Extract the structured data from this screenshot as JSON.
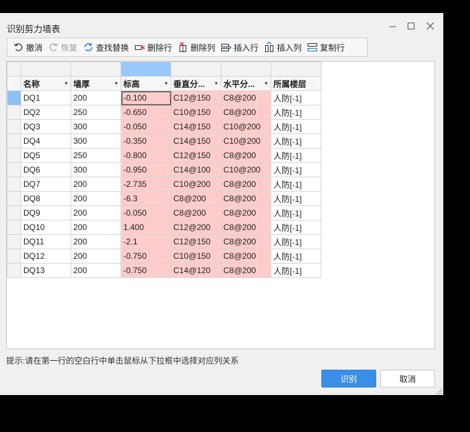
{
  "window": {
    "title": "识别剪力墙表"
  },
  "toolbar": {
    "items": [
      {
        "label": "撤消",
        "icon": "undo-icon",
        "enabled": true
      },
      {
        "label": "恢复",
        "icon": "redo-icon",
        "enabled": false
      },
      {
        "label": "查找替换",
        "icon": "find-replace-icon",
        "enabled": true
      },
      {
        "label": "删除行",
        "icon": "delete-row-icon",
        "enabled": true
      },
      {
        "label": "删除列",
        "icon": "delete-column-icon",
        "enabled": true
      },
      {
        "label": "插入行",
        "icon": "insert-row-icon",
        "enabled": true
      },
      {
        "label": "插入列",
        "icon": "insert-column-icon",
        "enabled": true
      },
      {
        "label": "复制行",
        "icon": "copy-row-icon",
        "enabled": true
      }
    ]
  },
  "grid": {
    "headers": [
      "名称",
      "墙厚",
      "标高",
      "垂直分...",
      "水平分...",
      "所属楼层"
    ],
    "rows": [
      [
        "DQ1",
        "200",
        "-0.100",
        "C12@150",
        "C8@200",
        "人防[-1]"
      ],
      [
        "DQ2",
        "250",
        "-0.650",
        "C10@150",
        "C8@200",
        "人防[-1]"
      ],
      [
        "DQ3",
        "300",
        "-0.050",
        "C14@150",
        "C10@200",
        "人防[-1]"
      ],
      [
        "DQ4",
        "300",
        "-0.350",
        "C14@150",
        "C10@200",
        "人防[-1]"
      ],
      [
        "DQ5",
        "250",
        "-0.800",
        "C12@150",
        "C8@200",
        "人防[-1]"
      ],
      [
        "DQ6",
        "300",
        "-0.950",
        "C14@100",
        "C10@200",
        "人防[-1]"
      ],
      [
        "DQ7",
        "200",
        "-2.735",
        "C10@200",
        "C8@200",
        "人防[-1]"
      ],
      [
        "DQ8",
        "200",
        "-6.3",
        "C8@200",
        "C8@200",
        "人防[-1]"
      ],
      [
        "DQ9",
        "200",
        "-0.050",
        "C8@200",
        "C8@200",
        "人防[-1]"
      ],
      [
        "DQ10",
        "200",
        "1.400",
        "C12@200",
        "C8@200",
        "人防[-1]"
      ],
      [
        "DQ11",
        "200",
        "-2.1",
        "C12@150",
        "C8@200",
        "人防[-1]"
      ],
      [
        "DQ12",
        "200",
        "-0.750",
        "C10@150",
        "C8@200",
        "人防[-1]"
      ],
      [
        "DQ13",
        "200",
        "-0.750",
        "C14@120",
        "C8@200",
        "人防[-1]"
      ]
    ],
    "highlight_columns": [
      2,
      3,
      4
    ],
    "selected_mapping_column": 2,
    "current_cell": {
      "row": 0,
      "col": 2
    }
  },
  "hint": "提示:请在第一行的空白行中单击鼠标从下拉框中选择对应列关系",
  "buttons": {
    "ok": "识别",
    "cancel": "取消"
  },
  "colors": {
    "highlight": "#ffcccc",
    "selected_header": "#99c8fb",
    "primary": "#3a8ee6"
  }
}
